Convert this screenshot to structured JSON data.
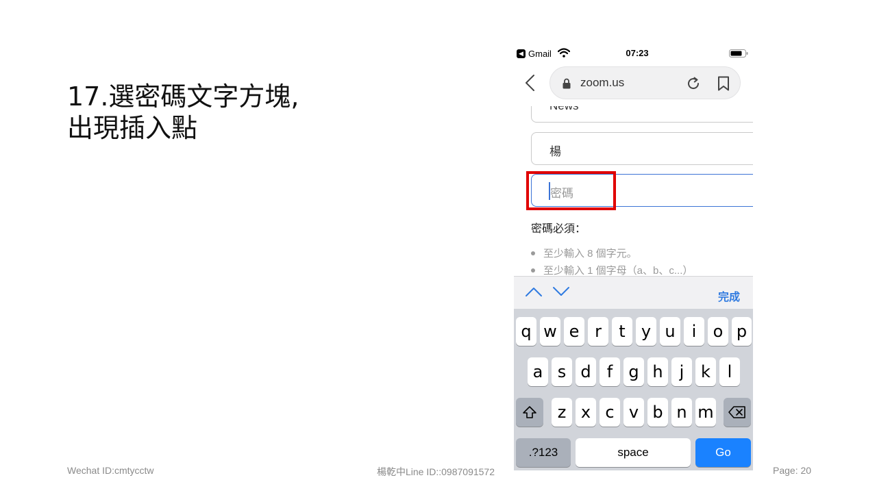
{
  "slide": {
    "title_line1": "17.選密碼文字方塊,",
    "title_line2": "出現插入點"
  },
  "footer": {
    "left": "Wechat ID:cmtyсctw",
    "center": "楊乾中Line ID::0987091572",
    "right": "Page: 20"
  },
  "phone": {
    "status": {
      "back_app": "Gmail",
      "time": "07:23"
    },
    "browser": {
      "url": "zoom.us"
    },
    "form": {
      "partial_field_value": "News",
      "name_field_value": "楊",
      "password_placeholder": "密碼",
      "rules_title": "密碼必須：",
      "rules": [
        "至少輸入 8 個字元。",
        "至少輸入 1 個字母（a、b、c...）"
      ]
    },
    "accessory": {
      "done_label": "完成"
    },
    "keyboard": {
      "row1": [
        "q",
        "w",
        "e",
        "r",
        "t",
        "y",
        "u",
        "i",
        "o",
        "p"
      ],
      "row2": [
        "a",
        "s",
        "d",
        "f",
        "g",
        "h",
        "j",
        "k",
        "l"
      ],
      "row3": [
        "z",
        "x",
        "c",
        "v",
        "b",
        "n",
        "m"
      ],
      "numbers_key": ".?123",
      "space_key": "space",
      "go_key": "Go"
    },
    "icons": {
      "wifi": "wifi-icon",
      "battery": "battery-icon",
      "back": "chevron-left-icon",
      "lock": "lock-icon",
      "reload": "reload-icon",
      "bookmark": "bookmark-icon",
      "shift": "shift-icon",
      "delete": "backspace-icon"
    },
    "colors": {
      "focus_blue": "#3b73d6",
      "highlight_red": "#e00000",
      "go_blue": "#1a82ff"
    }
  }
}
